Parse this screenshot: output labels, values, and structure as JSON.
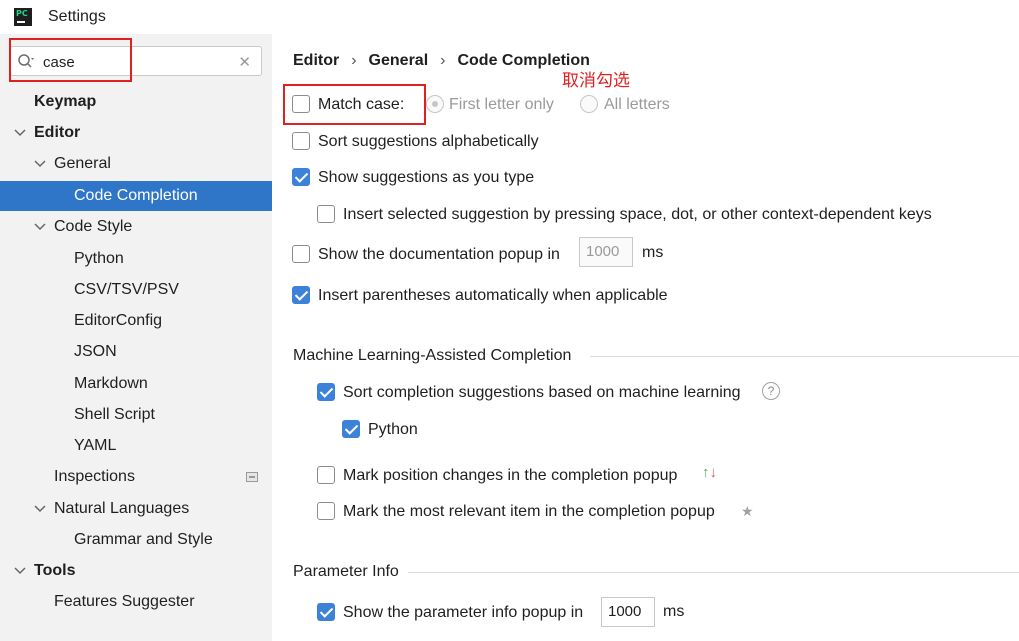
{
  "window": {
    "title": "Settings",
    "logo_text": "PC"
  },
  "search": {
    "value": "case"
  },
  "sidebar": {
    "items": [
      {
        "label": "Keymap"
      },
      {
        "label": "Editor"
      },
      {
        "label": "General"
      },
      {
        "label": "Code Completion"
      },
      {
        "label": "Code Style"
      },
      {
        "label": "Python"
      },
      {
        "label": "CSV/TSV/PSV"
      },
      {
        "label": "EditorConfig"
      },
      {
        "label": "JSON"
      },
      {
        "label": "Markdown"
      },
      {
        "label": "Shell Script"
      },
      {
        "label": "YAML"
      },
      {
        "label": "Inspections"
      },
      {
        "label": "Natural Languages"
      },
      {
        "label": "Grammar and Style"
      },
      {
        "label": "Tools"
      },
      {
        "label": "Features Suggester"
      }
    ]
  },
  "breadcrumb": {
    "items": [
      "Editor",
      "General",
      "Code Completion"
    ],
    "separator": "›"
  },
  "annotation": {
    "text": "取消勾选"
  },
  "options": {
    "match_case": {
      "label": "Match case:",
      "checked": false
    },
    "first_letter_only": {
      "label": "First letter only"
    },
    "all_letters": {
      "label": "All letters"
    },
    "sort_alpha": {
      "label": "Sort suggestions alphabetically"
    },
    "show_as_type": {
      "label": "Show suggestions as you type"
    },
    "insert_selected": {
      "label": "Insert selected suggestion by pressing space, dot, or other context-dependent keys"
    },
    "show_doc_popup": {
      "label": "Show the documentation popup in",
      "value": "1000",
      "unit": "ms"
    },
    "insert_parens": {
      "label": "Insert parentheses automatically when applicable"
    }
  },
  "ml_section": {
    "title": "Machine Learning-Assisted Completion",
    "sort_ml": {
      "label": "Sort completion suggestions based on machine learning"
    },
    "python": {
      "label": "Python"
    },
    "mark_position": {
      "label": "Mark position changes in the completion popup"
    },
    "mark_relevant": {
      "label": "Mark the most relevant item in the completion popup"
    }
  },
  "param_section": {
    "title": "Parameter Info",
    "show_param_popup": {
      "label": "Show the parameter info popup in",
      "value": "1000",
      "unit": "ms"
    }
  },
  "colors": {
    "selection": "#2f75c8",
    "checkbox_on": "#3c82d8",
    "annotation": "#e02020"
  }
}
